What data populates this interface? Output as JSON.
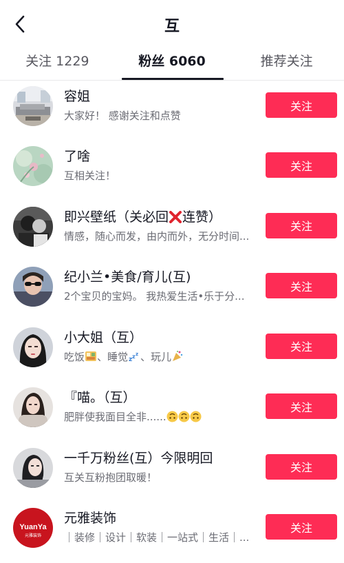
{
  "header": {
    "title": "互"
  },
  "tabs": [
    {
      "label": "关注 1229",
      "active": false
    },
    {
      "label": "粉丝 6060",
      "active": true
    },
    {
      "label": "推荐关注",
      "active": false
    }
  ],
  "colors": {
    "accent": "#fe2c55",
    "text": "#161823",
    "subtext": "#6b6c74"
  },
  "follow_label": "关注",
  "users": [
    {
      "name": "容姐",
      "desc": "大家好！ 感谢关注和点赞",
      "avatar": "living-room-photo"
    },
    {
      "name": "了啥",
      "desc": "互相关注！",
      "avatar": "flowers-photo"
    },
    {
      "name_a": "即兴壁纸（关必回",
      "name_b": "连赞）",
      "name_icon": "red-x-icon",
      "desc": "情感，随心而发，由内而外，无分时间...",
      "avatar": "couple-bw-photo"
    },
    {
      "name": "纪小兰•美食/育儿(互)",
      "desc": "2个宝贝的宝妈。 我热爱生活•乐于分...",
      "avatar": "woman-sunglasses-photo"
    },
    {
      "name": "小大姐（互）",
      "desc_a": "吃饭",
      "desc_b": "、睡觉",
      "desc_c": "、玩儿",
      "desc_icons": [
        "rice-bowl-icon",
        "sleep-zzz-icon",
        "party-popper-icon"
      ],
      "avatar": "woman-portrait-photo"
    },
    {
      "name": "『喵。（互）",
      "desc": "肥胖使我面目全非......",
      "desc_icons": [
        "upside-down-face-icon",
        "upside-down-face-icon",
        "upside-down-face-icon"
      ],
      "avatar": "woman-fur-collar-photo"
    },
    {
      "name": "一千万粉丝(互）今限明回",
      "desc": "互关互粉抱团取暖！",
      "avatar": "woman-side-photo"
    },
    {
      "name": "元雅装饰",
      "desc": "｜装修｜设计｜软装｜一站式｜生活｜...",
      "avatar": "yuanya-logo",
      "logo_text": "YuanYa",
      "logo_subtext": "元雅装饰"
    }
  ]
}
